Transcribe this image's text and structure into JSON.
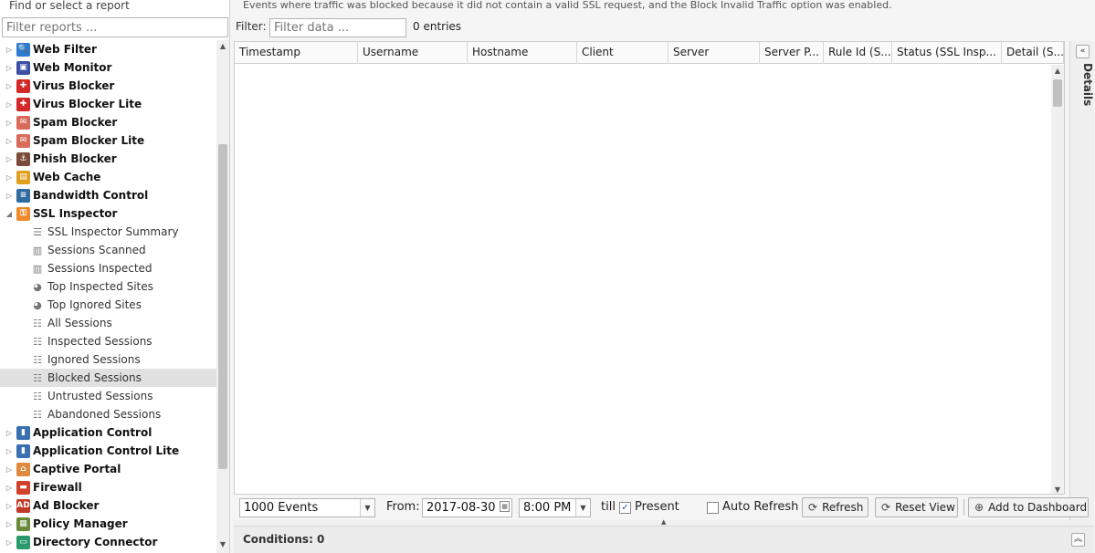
{
  "sidebar": {
    "title": "Find or select a report",
    "filter_placeholder": "Filter reports ...",
    "items": [
      {
        "type": "app",
        "label": "Web Filter",
        "icon": "web-filter-icon",
        "color": "#2d7bd1",
        "glyph": "🔍",
        "expanded": false
      },
      {
        "type": "app",
        "label": "Web Monitor",
        "icon": "web-monitor-icon",
        "color": "#3c4fa3",
        "glyph": "▣",
        "expanded": false
      },
      {
        "type": "app",
        "label": "Virus Blocker",
        "icon": "virus-blocker-icon",
        "color": "#d42828",
        "glyph": "✚",
        "expanded": false
      },
      {
        "type": "app",
        "label": "Virus Blocker Lite",
        "icon": "virus-blocker-lite-icon",
        "color": "#d42828",
        "glyph": "✚",
        "expanded": false
      },
      {
        "type": "app",
        "label": "Spam Blocker",
        "icon": "spam-blocker-icon",
        "color": "#d86a5a",
        "glyph": "✉",
        "expanded": false
      },
      {
        "type": "app",
        "label": "Spam Blocker Lite",
        "icon": "spam-blocker-lite-icon",
        "color": "#d86a5a",
        "glyph": "✉",
        "expanded": false
      },
      {
        "type": "app",
        "label": "Phish Blocker",
        "icon": "phish-blocker-icon",
        "color": "#7a4a3a",
        "glyph": "⚓",
        "expanded": false
      },
      {
        "type": "app",
        "label": "Web Cache",
        "icon": "web-cache-icon",
        "color": "#e0a020",
        "glyph": "▤",
        "expanded": false
      },
      {
        "type": "app",
        "label": "Bandwidth Control",
        "icon": "bandwidth-control-icon",
        "color": "#2f6aa0",
        "glyph": "≡",
        "expanded": false
      },
      {
        "type": "app",
        "label": "SSL Inspector",
        "icon": "ssl-inspector-icon",
        "color": "#f08a2a",
        "glyph": "⚿",
        "expanded": true
      },
      {
        "type": "report",
        "label": "SSL Inspector Summary",
        "icon": "text-report-icon",
        "glyph": "☰"
      },
      {
        "type": "report",
        "label": "Sessions Scanned",
        "icon": "bar-chart-icon",
        "glyph": "▥"
      },
      {
        "type": "report",
        "label": "Sessions Inspected",
        "icon": "bar-chart-icon",
        "glyph": "▥"
      },
      {
        "type": "report",
        "label": "Top Inspected Sites",
        "icon": "pie-chart-icon",
        "glyph": "◕"
      },
      {
        "type": "report",
        "label": "Top Ignored Sites",
        "icon": "pie-chart-icon",
        "glyph": "◕"
      },
      {
        "type": "report",
        "label": "All Sessions",
        "icon": "list-icon",
        "glyph": "☷"
      },
      {
        "type": "report",
        "label": "Inspected Sessions",
        "icon": "list-icon",
        "glyph": "☷"
      },
      {
        "type": "report",
        "label": "Ignored Sessions",
        "icon": "list-icon",
        "glyph": "☷"
      },
      {
        "type": "report",
        "label": "Blocked Sessions",
        "icon": "list-icon",
        "glyph": "☷",
        "selected": true
      },
      {
        "type": "report",
        "label": "Untrusted Sessions",
        "icon": "list-icon",
        "glyph": "☷"
      },
      {
        "type": "report",
        "label": "Abandoned Sessions",
        "icon": "list-icon",
        "glyph": "☷"
      },
      {
        "type": "app",
        "label": "Application Control",
        "icon": "application-control-icon",
        "color": "#3a6fb0",
        "glyph": "▮",
        "expanded": false
      },
      {
        "type": "app",
        "label": "Application Control Lite",
        "icon": "application-control-lite-icon",
        "color": "#3a6fb0",
        "glyph": "▮",
        "expanded": false
      },
      {
        "type": "app",
        "label": "Captive Portal",
        "icon": "captive-portal-icon",
        "color": "#e08a40",
        "glyph": "⌂",
        "expanded": false
      },
      {
        "type": "app",
        "label": "Firewall",
        "icon": "firewall-icon",
        "color": "#d0402a",
        "glyph": "▬",
        "expanded": false
      },
      {
        "type": "app",
        "label": "Ad Blocker",
        "icon": "ad-blocker-icon",
        "color": "#c0392b",
        "glyph": "AD",
        "expanded": false
      },
      {
        "type": "app",
        "label": "Policy Manager",
        "icon": "policy-manager-icon",
        "color": "#6a8a3a",
        "glyph": "▦",
        "expanded": false
      },
      {
        "type": "app",
        "label": "Directory Connector",
        "icon": "directory-connector-icon",
        "color": "#2a9a6a",
        "glyph": "▭",
        "expanded": false
      }
    ]
  },
  "main": {
    "description": "Events where traffic was blocked because it did not contain a valid SSL request, and the Block Invalid Traffic option was enabled.",
    "filter_label": "Filter:",
    "filter_placeholder": "Filter data ...",
    "entries": "0 entries",
    "columns": [
      "Timestamp",
      "Username",
      "Hostname",
      "Client",
      "Server",
      "Server P...",
      "Rule Id (S...",
      "Status (SSL Insp...",
      "Detail (S..."
    ]
  },
  "details": {
    "label": "Details"
  },
  "toolbar": {
    "events_value": "1000 Events",
    "from_label": "From:",
    "date_value": "2017-08-30",
    "time_value": "8:00 PM",
    "till_label": "till",
    "present_label": "Present",
    "present_checked": true,
    "auto_refresh_label": "Auto Refresh",
    "auto_refresh_checked": false,
    "refresh_label": "Refresh",
    "reset_view_label": "Reset View",
    "add_dashboard_label": "Add to Dashboard"
  },
  "conditions": {
    "label": "Conditions: 0"
  }
}
